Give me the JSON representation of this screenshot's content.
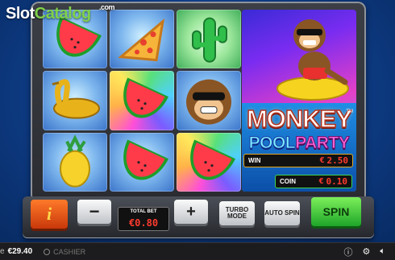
{
  "watermark": {
    "brand_slot": "Slot",
    "brand_catalog": "Catalog",
    "brand_com": ".com"
  },
  "game": {
    "logo_line1": "MONKEY",
    "logo_pool": "POOL",
    "logo_party": "PARTY",
    "tm": "TM"
  },
  "reels": [
    [
      "watermelon",
      "pizza",
      "cactus-float"
    ],
    [
      "golden-swan-float",
      "watermelon",
      "monkey"
    ],
    [
      "pineapple-float",
      "watermelon",
      "watermelon"
    ]
  ],
  "meters": {
    "win_label": "WIN",
    "win_currency": "€",
    "win_value": "2.50",
    "coin_label": "COIN",
    "coin_currency": "€",
    "coin_value": "0.10"
  },
  "controls": {
    "info_label": "i",
    "minus_label": "−",
    "total_bet_label": "TOTAL BET",
    "total_bet_value": "€0.80",
    "plus_label": "+",
    "turbo_label": "TURBO MODE",
    "auto_spin_label": "AUTO SPIN",
    "spin_label": "SPIN"
  },
  "bottom_bar": {
    "balance_label": "e",
    "balance": "€29.40",
    "cashier": "CASHIER"
  },
  "icons": {
    "info": "info-icon",
    "settings": "gear-icon",
    "sound": "speaker-icon"
  },
  "colors": {
    "meter_red": "#ff3b2e",
    "spin_green": "#1fa52a",
    "info_orange": "#ff7a2a"
  }
}
